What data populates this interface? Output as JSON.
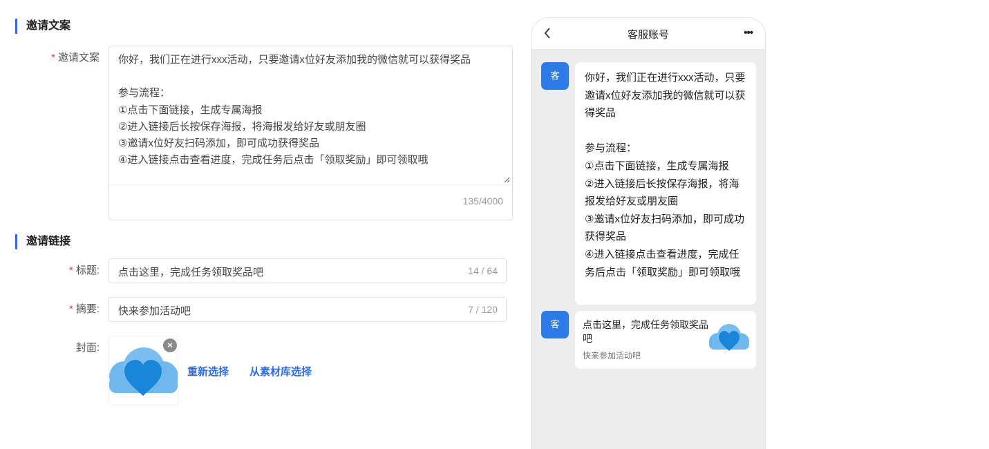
{
  "invite_copy": {
    "section_title": "邀请文案",
    "field_label": "邀请文案",
    "required_mark": "*",
    "text": "你好，我们正在进行xxx活动，只要邀请x位好友添加我的微信就可以获得奖品\n\n参与流程：\n①点击下面链接，生成专属海报\n②进入链接后长按保存海报，将海报发给好友或朋友圈\n③邀请x位好友扫码添加，即可成功获得奖品\n④进入链接点击查看进度，完成任务后点击「领取奖励」即可领取哦",
    "counter": "135/4000"
  },
  "invite_link": {
    "section_title": "邀请链接",
    "title_label": "标题:",
    "title_value": "点击这里，完成任务领取奖品吧",
    "title_counter": "14 / 64",
    "summary_label": "摘要:",
    "summary_value": "快来参加活动吧",
    "summary_counter": "7 / 120",
    "cover_label": "封面:",
    "cover_close": "×",
    "reselect": "重新选择",
    "from_library": "从素材库选择"
  },
  "preview": {
    "title": "客服账号",
    "more": "•••",
    "avatar_char": "客",
    "message_text": "你好，我们正在进行xxx活动，只要邀请x位好友添加我的微信就可以获得奖品\n\n参与流程：\n①点击下面链接，生成专属海报\n②进入链接后长按保存海报，将海报发给好友或朋友圈\n③邀请x位好友扫码添加，即可成功获得奖品\n④进入链接点击查看进度，完成任务后点击「领取奖励」即可领取哦",
    "link_card_title": "点击这里，完成任务领取奖品吧",
    "link_card_desc": "快来参加活动吧"
  },
  "colors": {
    "accent": "#2d6ee8",
    "required": "#e0463f",
    "avatar": "#2d7be8",
    "cloud_light": "#6fb8ee",
    "heart": "#1a86d9"
  }
}
